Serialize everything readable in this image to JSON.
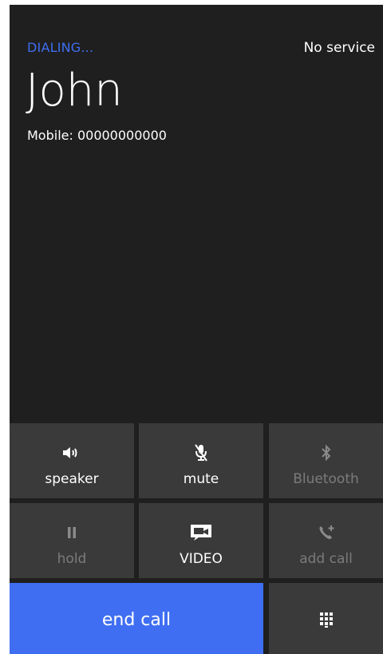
{
  "status": {
    "call_state": "DIALING...",
    "network": "No service"
  },
  "contact": {
    "name": "John",
    "number_label": "Mobile: 00000000000"
  },
  "controls": {
    "speaker": "speaker",
    "mute": "mute",
    "bluetooth": "Bluetooth",
    "hold": "hold",
    "video": "VIDEO",
    "add_call": "add call",
    "end_call": "end call"
  },
  "icons": {
    "speaker": "speaker-icon",
    "mute": "mic-mute-icon",
    "bluetooth": "bluetooth-icon",
    "hold": "pause-icon",
    "video": "video-camera-icon",
    "add_call": "phone-add-icon",
    "keypad": "keypad-icon"
  },
  "colors": {
    "accent": "#3f6ef2",
    "background": "#1f1f1f",
    "tile": "#3a3a3a",
    "disabled_text": "#7b7b7b"
  }
}
